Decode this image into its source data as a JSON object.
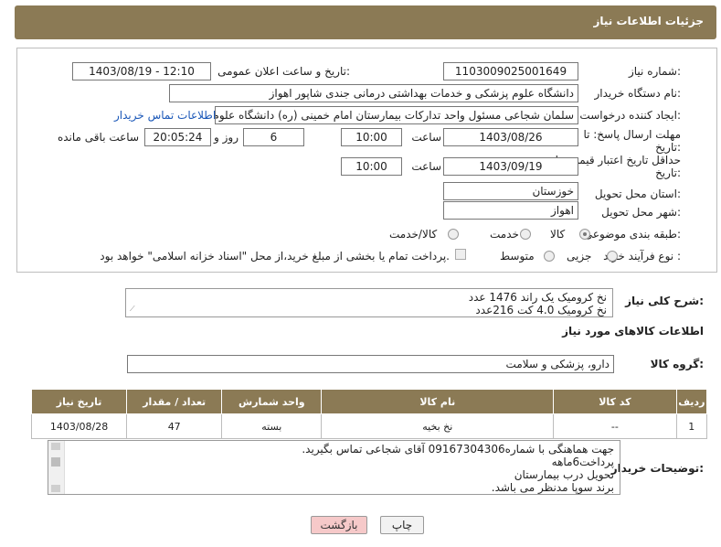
{
  "header": {
    "title": "جزئیات اطلاعات نیاز"
  },
  "form": {
    "need_number_label": "شماره نیاز:",
    "need_number_value": "1103009025001649",
    "announce_label": "تاریخ و ساعت اعلان عمومی:",
    "announce_value": "1403/08/19 - 12:10",
    "buyer_org_label": "نام دستگاه خریدار:",
    "buyer_org_value": "دانشگاه علوم پزشکی و خدمات بهداشتی درمانی جندی شاپور اهواز",
    "creator_label": "ایجاد کننده درخواست:",
    "creator_value": "سلمان شجاعی مسئول واحد تدارکات بیمارستان امام خمینی (ره) دانشگاه علوم",
    "contact_link": "اطلاعات تماس خریدار",
    "deadline_label_1": "مهلت ارسال پاسخ: تا",
    "deadline_label_2": "تاریخ:",
    "deadline_date": "1403/08/26",
    "time_label": "ساعت",
    "deadline_time": "10:00",
    "days_value": "6",
    "days_label": "روز و",
    "remaining_time": "20:05:24",
    "remaining_label": "ساعت باقی مانده",
    "validity_label_1": "حداقل تاریخ اعتبار قیمت: تا",
    "validity_label_2": "تاریخ:",
    "validity_date": "1403/09/19",
    "validity_time": "10:00",
    "province_label": "استان محل تحویل:",
    "province_value": "خوزستان",
    "city_label": "شهر محل تحویل:",
    "city_value": "اهواز",
    "category_label": "طبقه بندی موضوعی:",
    "category_options": [
      "کالا",
      "خدمت",
      "کالا/خدمت"
    ],
    "purchase_label": "نوع فرآیند خرید :",
    "purchase_options": [
      "جزیی",
      "متوسط"
    ],
    "payment_text": "پرداخت تمام یا بخشی از مبلغ خرید،از محل \"اسناد خزانه اسلامی\" خواهد بود."
  },
  "description": {
    "label": "شرح کلی نیاز:",
    "lines": [
      "نخ کرومیک یک راند 1476 عدد",
      "نخ کرومیک 4.0 کت 216عدد"
    ]
  },
  "goods": {
    "section_title": "اطلاعات کالاهای مورد نیاز",
    "group_label": "گروه کالا:",
    "group_value": "دارو، پزشکی و سلامت",
    "columns": [
      "ردیف",
      "کد کالا",
      "نام کالا",
      "واحد شمارش",
      "تعداد / مقدار",
      "تاریخ نیاز"
    ],
    "rows": [
      {
        "row": "1",
        "code": "--",
        "name": "نخ بخیه",
        "unit": "بسته",
        "qty": "47",
        "date": "1403/08/28"
      }
    ]
  },
  "notes": {
    "label": "توضیحات خریدار:",
    "lines": [
      "جهت هماهنگی با شماره09167304306 آقای شجاعی تماس بگیرید.",
      "پرداخت6ماهه",
      "تحویل درب بیمارستان",
      "برند سوپا مدنظر می باشد."
    ]
  },
  "buttons": {
    "print": "چاپ",
    "back": "بازگشت"
  },
  "colors": {
    "header_bg": "#8b7a55",
    "link": "#1a57b8",
    "back_button": "#f6c9c9"
  }
}
